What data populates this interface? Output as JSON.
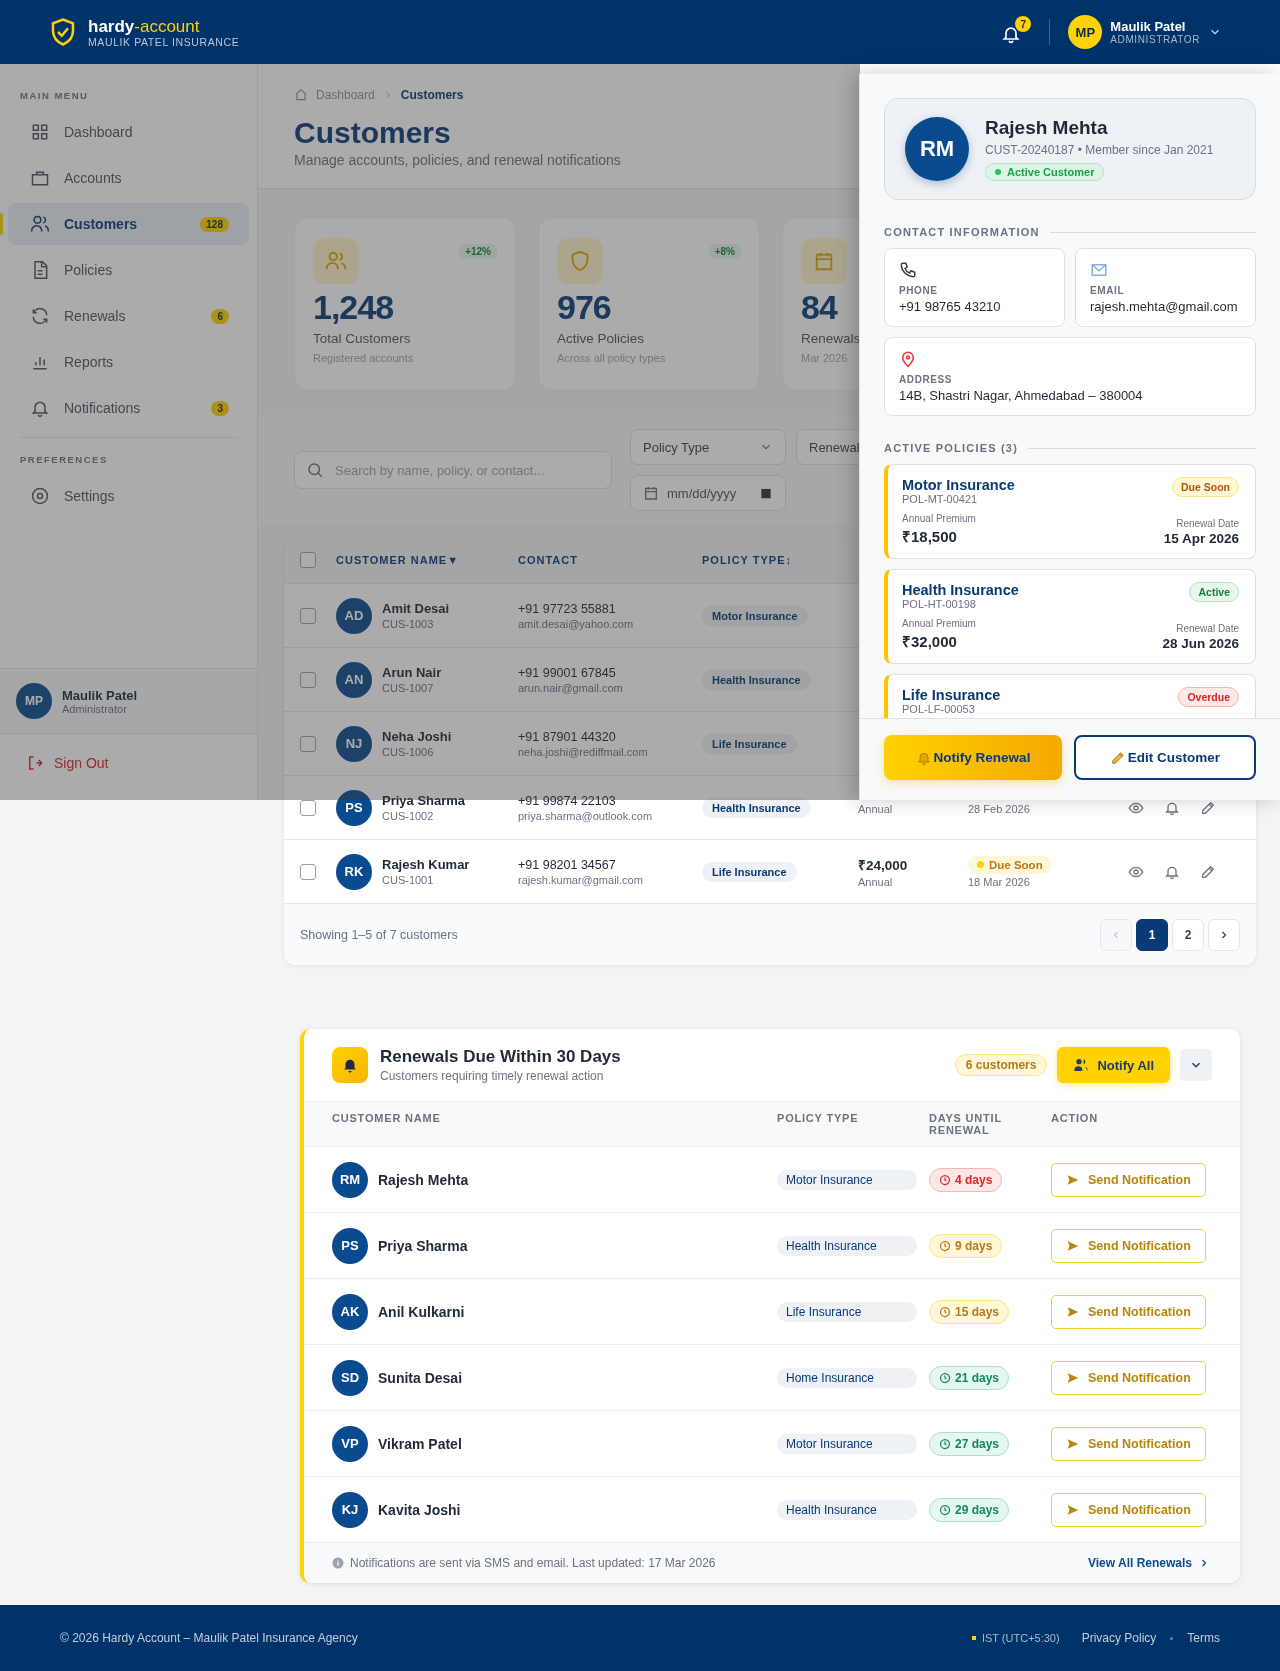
{
  "header": {
    "brand_main": "hardy",
    "brand_accent": "-account",
    "brand_sub": "MAULIK PATEL INSURANCE",
    "notification_count": "7",
    "user": {
      "initials": "MP",
      "name": "Maulik Patel",
      "role": "ADMINISTRATOR"
    }
  },
  "sidebar": {
    "sections": [
      {
        "title": "MAIN MENU",
        "items": [
          {
            "label": "Dashboard",
            "selected": false
          },
          {
            "label": "Accounts",
            "selected": false
          },
          {
            "label": "Customers",
            "badge": "128",
            "selected": true
          },
          {
            "label": "Policies",
            "selected": false
          },
          {
            "label": "Renewals",
            "badge": "6",
            "selected": false
          },
          {
            "label": "Reports",
            "selected": false
          },
          {
            "label": "Notifications",
            "badge": "3",
            "selected": false
          }
        ]
      },
      {
        "title": "PREFERENCES",
        "items": [
          {
            "label": "Settings",
            "selected": false
          }
        ]
      }
    ],
    "user": {
      "initials": "MP",
      "name": "Maulik Patel",
      "role": "Administrator"
    },
    "sign_out": "Sign Out"
  },
  "page": {
    "breadcrumb": [
      "Dashboard",
      "Customers"
    ],
    "title": "Customers",
    "subtitle": "Manage accounts, policies, and renewal notifications"
  },
  "stats": [
    {
      "value": "1,248",
      "label": "Total Customers",
      "note": "Registered accounts",
      "change": "+12%"
    },
    {
      "value": "976",
      "label": "Active Policies",
      "note": "Across all policy types",
      "change": "+8%"
    },
    {
      "value": "84",
      "label": "Renewals",
      "note": "Mar 2026"
    }
  ],
  "filters": {
    "search": {
      "placeholder": "Search by name, policy, or contact..."
    },
    "selects": [
      "Policy Type",
      "Renewal"
    ],
    "date": {
      "placeholder": "mm/dd/yyyy"
    }
  },
  "table": {
    "select_all_checked": false,
    "columns": [
      {
        "label": "CUSTOMER NAME",
        "sort_mark": "▼"
      },
      {
        "label": "CONTACT"
      },
      {
        "label": "POLICY TYPE",
        "sort_mark": "↕"
      }
    ],
    "rows": [
      {
        "checked": false,
        "initials": "AD",
        "name": "Amit Desai",
        "id": "CUS-1003",
        "phone": "+91 97723 55881",
        "email": "amit.desai@yahoo.com",
        "policy": "Motor Insurance"
      },
      {
        "checked": false,
        "initials": "AN",
        "name": "Arun Nair",
        "id": "CUS-1007",
        "phone": "+91 99001 67845",
        "email": "arun.nair@gmail.com",
        "policy": "Health Insurance"
      },
      {
        "checked": false,
        "initials": "NJ",
        "name": "Neha Joshi",
        "id": "CUS-1006",
        "phone": "+91 87901 44320",
        "email": "neha.joshi@rediffmail.com",
        "policy": "Life Insurance"
      },
      {
        "checked": false,
        "initials": "PS",
        "name": "Priya Sharma",
        "id": "CUS-1002",
        "phone": "+91 99874 22103",
        "email": "priya.sharma@outlook.com",
        "policy": "Health Insurance",
        "period": "Annual",
        "date": "28 Feb 2026",
        "actions": true
      },
      {
        "checked": false,
        "initials": "RK",
        "name": "Rajesh Kumar",
        "id": "CUS-1001",
        "phone": "+91 98201 34567",
        "email": "rajesh.kumar@gmail.com",
        "policy": "Life Insurance",
        "premium": "₹24,000",
        "period": "Annual",
        "status": "Due Soon",
        "kind": "due",
        "date": "18 Mar 2026",
        "actions": true
      }
    ],
    "summary": "Showing 1–5 of 7 customers",
    "prev_disabled": true,
    "pages": [
      {
        "label": "1",
        "selected": true
      },
      {
        "label": "2",
        "selected": false
      }
    ]
  },
  "drawer": {
    "initials": "RM",
    "name": "Rajesh Mehta",
    "meta": "CUST-20240187 • Member since Jan 2021",
    "status": "Active Customer",
    "contact_title": "CONTACT INFORMATION",
    "contacts": [
      {
        "label": "PHONE",
        "value": "+91 98765 43210"
      },
      {
        "label": "EMAIL",
        "value": "rajesh.mehta@gmail.com"
      },
      {
        "label": "ADDRESS",
        "value": "14B, Shastri Nagar, Ahmedabad – 380004"
      }
    ],
    "policies_title": "ACTIVE POLICIES (3)",
    "policies": [
      {
        "name": "Motor Insurance",
        "number": "POL-MT-00421",
        "premium_label": "Annual Premium",
        "premium": "₹18,500",
        "date_label": "Renewal Date",
        "date": "15 Apr 2026",
        "status": "Due Soon",
        "kind": "due"
      },
      {
        "name": "Health Insurance",
        "number": "POL-HT-00198",
        "premium_label": "Annual Premium",
        "premium": "₹32,000",
        "date_label": "Renewal Date",
        "date": "28 Jun 2026",
        "status": "Active",
        "kind": "active"
      },
      {
        "name": "Life Insurance",
        "number": "POL-LF-00053",
        "status": "Overdue",
        "kind": "overdue"
      }
    ],
    "buttons": [
      "Notify Renewal",
      "Edit Customer"
    ]
  },
  "renewals": {
    "title": "Renewals Due Within 30 Days",
    "subtitle": "Customers requiring timely renewal action",
    "count": "6 customers",
    "notify_all": "Notify All",
    "columns": [
      "CUSTOMER NAME",
      "POLICY TYPE",
      "DAYS UNTIL RENEWAL",
      "ACTION"
    ],
    "rows": [
      {
        "initials": "RM",
        "name": "Rajesh Mehta",
        "policy": "Motor Insurance",
        "days": "4 days",
        "kind": "high",
        "action": "Send Notification"
      },
      {
        "initials": "PS",
        "name": "Priya Sharma",
        "policy": "Health Insurance",
        "days": "9 days",
        "kind": "medium",
        "action": "Send Notification"
      },
      {
        "initials": "AK",
        "name": "Anil Kulkarni",
        "policy": "Life Insurance",
        "days": "15 days",
        "kind": "medium",
        "action": "Send Notification"
      },
      {
        "initials": "SD",
        "name": "Sunita Desai",
        "policy": "Home Insurance",
        "days": "21 days",
        "kind": "low",
        "action": "Send Notification"
      },
      {
        "initials": "VP",
        "name": "Vikram Patel",
        "policy": "Motor Insurance",
        "days": "27 days",
        "kind": "low",
        "action": "Send Notification"
      },
      {
        "initials": "KJ",
        "name": "Kavita Joshi",
        "policy": "Health Insurance",
        "days": "29 days",
        "kind": "low",
        "action": "Send Notification"
      }
    ],
    "note": "Notifications are sent via SMS and email. Last updated: 17 Mar 2026",
    "view_all": "View All Renewals"
  },
  "footer": {
    "copyright": "© 2026 Hardy Account – Maulik Patel Insurance Agency",
    "timezone": "IST (UTC+5:30)",
    "links": [
      "Privacy Policy",
      "Terms"
    ]
  }
}
